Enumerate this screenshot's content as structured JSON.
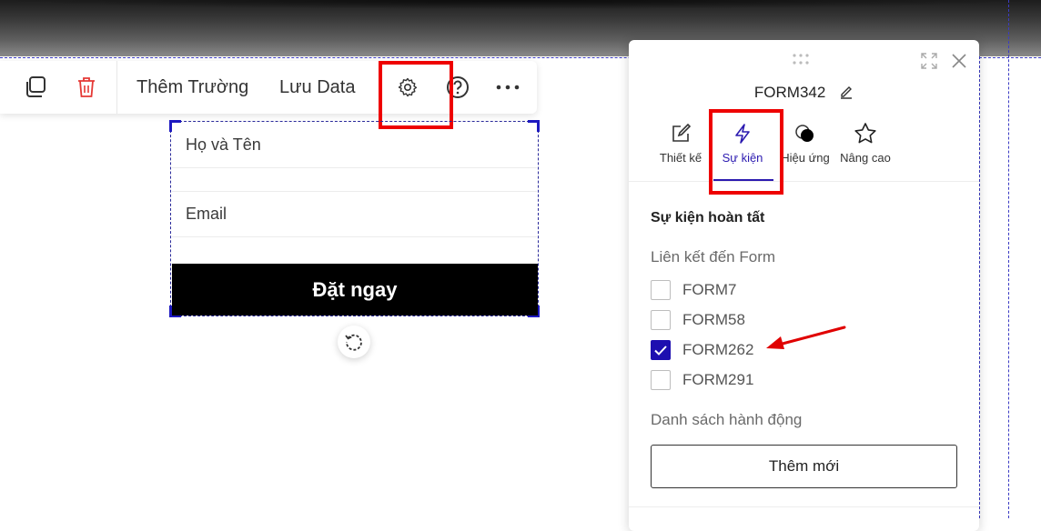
{
  "toolbar": {
    "add_field_label": "Thêm Trường",
    "save_data_label": "Lưu Data"
  },
  "form": {
    "fields": [
      {
        "label": "Họ và Tên"
      },
      {
        "label": "Email"
      }
    ],
    "submit_label": "Đặt ngay"
  },
  "panel": {
    "title": "FORM342",
    "tabs": [
      {
        "label": "Thiết kế",
        "icon": "edit-icon"
      },
      {
        "label": "Sự kiện",
        "icon": "lightning-icon",
        "active": true
      },
      {
        "label": "Hiệu ứng",
        "icon": "effect-icon"
      },
      {
        "label": "Nâng cao",
        "icon": "star-icon"
      }
    ],
    "section_title": "Sự kiện hoàn tất",
    "link_label": "Liên kết đến Form",
    "forms": [
      {
        "label": "FORM7",
        "checked": false
      },
      {
        "label": "FORM58",
        "checked": false
      },
      {
        "label": "FORM262",
        "checked": true
      },
      {
        "label": "FORM291",
        "checked": false
      }
    ],
    "actions_label": "Danh sách hành động",
    "add_new_label": "Thêm mới"
  },
  "colors": {
    "accent": "#2b1ab0",
    "highlight": "#ee0000",
    "danger": "#e53935",
    "submit_bg": "#000000"
  }
}
